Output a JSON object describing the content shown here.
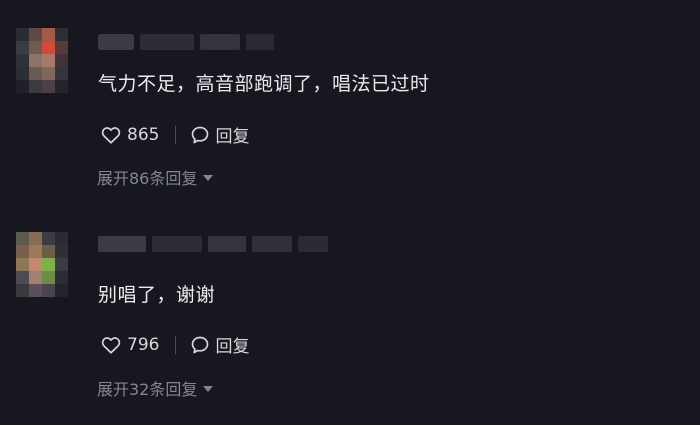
{
  "comments": [
    {
      "text": "气力不足，高音部跑调了，唱法已过时",
      "likes": "865",
      "reply_label": "回复",
      "expand_label": "展开86条回复",
      "avatar_pixels": [
        "#2a2b33",
        "#5b4a46",
        "#a55a48",
        "#2d2e36",
        "#3b3c44",
        "#6f5a52",
        "#d34a3a",
        "#5a3a36",
        "#2f3038",
        "#8b7468",
        "#a9786a",
        "#3f3338",
        "#2c2d35",
        "#6a5a54",
        "#80675c",
        "#33343c",
        "#1f2028",
        "#3b3a42",
        "#4a4048",
        "#22232b"
      ]
    },
    {
      "text": "别唱了，谢谢",
      "likes": "796",
      "reply_label": "回复",
      "expand_label": "展开32条回复",
      "avatar_pixels": [
        "#5b5a4e",
        "#8a6a52",
        "#3d3c44",
        "#2a2b33",
        "#7a5e4c",
        "#9a7a5a",
        "#6b5e48",
        "#2e2f37",
        "#8e7658",
        "#c28a6a",
        "#7fb04a",
        "#3a3b43",
        "#4e4a52",
        "#a08070",
        "#6c8a48",
        "#2b2c34",
        "#3a3940",
        "#5a5058",
        "#4a4450",
        "#22232b"
      ]
    }
  ],
  "colors": {
    "background": "#16171f",
    "text": "#ececef",
    "muted": "#85868f"
  }
}
